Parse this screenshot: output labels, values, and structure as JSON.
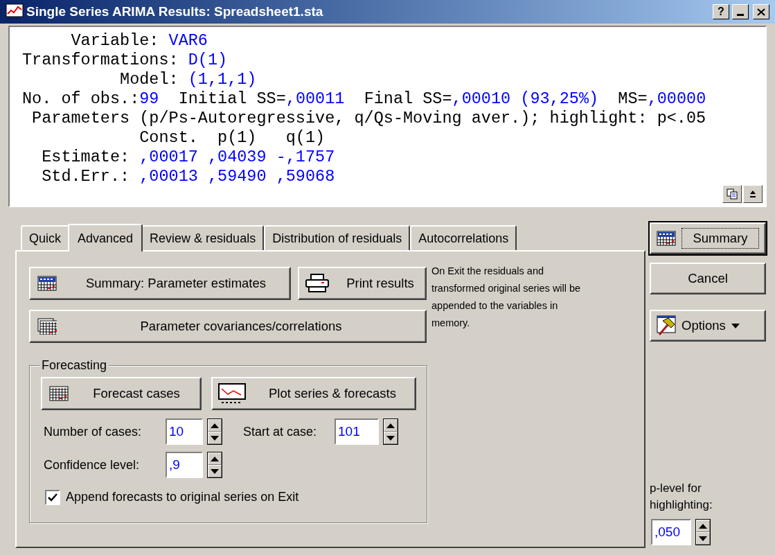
{
  "window": {
    "title": "Single Series ARIMA Results: Spreadsheet1.sta",
    "help_button": "?"
  },
  "output": {
    "lines": [
      [
        {
          "text": "     Variable: ",
          "kind": "label"
        },
        {
          "text": "VAR6",
          "kind": "value"
        }
      ],
      [
        {
          "text": "Transformations: ",
          "kind": "label"
        },
        {
          "text": "D(1)",
          "kind": "value"
        }
      ],
      [
        {
          "text": "          Model: ",
          "kind": "label"
        },
        {
          "text": "(1,1,1)",
          "kind": "value"
        }
      ],
      [
        {
          "text": "No. of obs.:",
          "kind": "label"
        },
        {
          "text": "99",
          "kind": "value"
        },
        {
          "text": "  Initial SS=",
          "kind": "label"
        },
        {
          "text": ",00011",
          "kind": "value"
        },
        {
          "text": "  Final SS=",
          "kind": "label"
        },
        {
          "text": ",00010 (93,25%)",
          "kind": "value"
        },
        {
          "text": "  MS=",
          "kind": "label"
        },
        {
          "text": ",00000",
          "kind": "value"
        }
      ],
      [
        {
          "text": " Parameters (p/Ps-Autoregressive, q/Qs-Moving aver.); highlight: p<.05",
          "kind": "label"
        }
      ],
      [
        {
          "text": "            Const.  p(1)   q(1)",
          "kind": "label"
        }
      ],
      [
        {
          "text": "  Estimate: ",
          "kind": "label"
        },
        {
          "text": ",00017 ,04039 -,1757",
          "kind": "value"
        }
      ],
      [
        {
          "text": "  Std.Err.: ",
          "kind": "label"
        },
        {
          "text": ",00013 ,59490 ,59068",
          "kind": "value"
        }
      ]
    ]
  },
  "tabs": [
    {
      "label": "Quick",
      "selected": false
    },
    {
      "label": "Advanced",
      "selected": true
    },
    {
      "label": "Review & residuals",
      "selected": false
    },
    {
      "label": "Distribution of residuals",
      "selected": false
    },
    {
      "label": "Autocorrelations",
      "selected": false
    }
  ],
  "advanced": {
    "buttons": [
      {
        "label": "Summary:  Parameter estimates",
        "kind": "summary"
      },
      {
        "label": "Print results",
        "kind": "print"
      },
      {
        "label": "Parameter covariances/correlations",
        "kind": "matrix"
      }
    ],
    "note": "On Exit the residuals and transformed original series will be appended to the variables in memory.",
    "forecasting": {
      "title": "Forecasting",
      "buttons": [
        {
          "label": "Forecast cases",
          "kind": "grid"
        },
        {
          "label": "Plot series & forecasts",
          "kind": "plot"
        }
      ],
      "spinners": [
        {
          "label": "Number of cases:",
          "value": "10"
        },
        {
          "label": "Start at case:",
          "value": "101"
        },
        {
          "label": "Confidence level:",
          "value": ",9"
        }
      ],
      "checkbox": {
        "label": "Append forecasts to original series on Exit",
        "checked": true
      }
    }
  },
  "side_buttons": [
    {
      "label": "Summary",
      "kind": "summary",
      "default": true
    },
    {
      "label": "Cancel",
      "kind": "plain",
      "default": false
    },
    {
      "label": "Options",
      "kind": "options",
      "default": false
    }
  ],
  "p_level": {
    "label": "p-level for highlighting:",
    "value": ",050"
  }
}
